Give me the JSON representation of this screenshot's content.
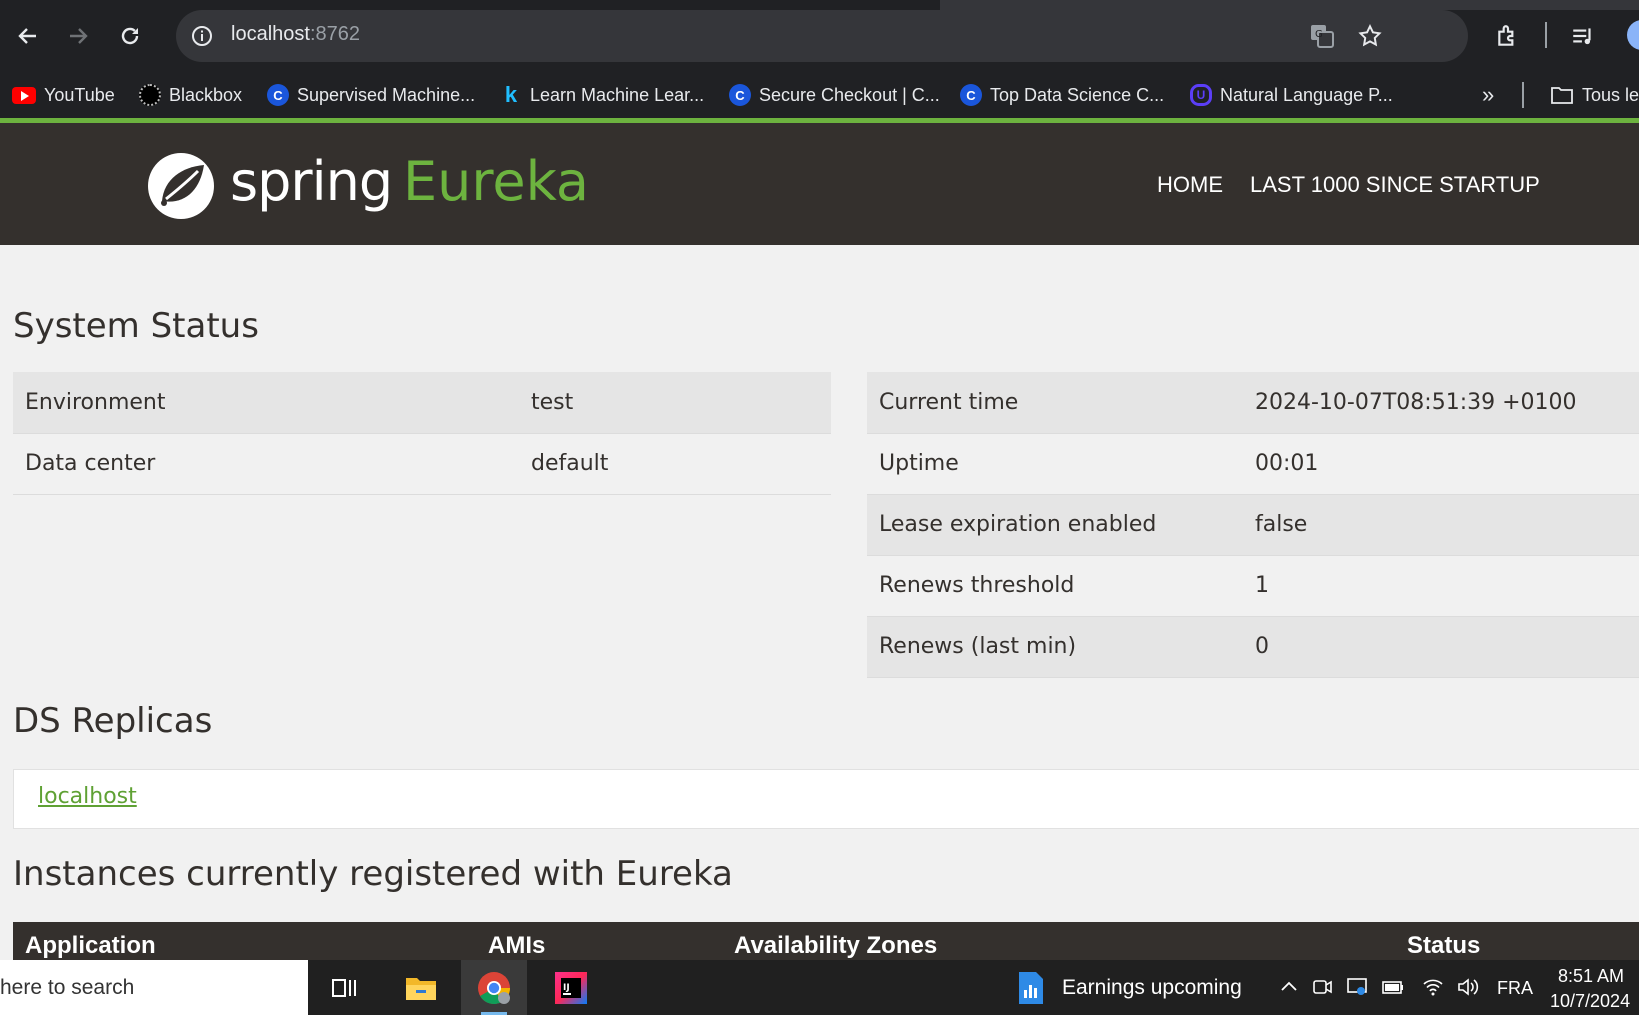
{
  "browser": {
    "url_host": "localhost",
    "url_port": ":8762",
    "bookmarks": [
      {
        "label": "YouTube",
        "icon": "youtube-icon"
      },
      {
        "label": "Blackbox",
        "icon": "blackbox-icon"
      },
      {
        "label": "Supervised Machine...",
        "icon": "coursera-icon"
      },
      {
        "label": "Learn Machine Lear...",
        "icon": "kaggle-icon"
      },
      {
        "label": "Secure Checkout | C...",
        "icon": "coursera-icon"
      },
      {
        "label": "Top Data Science C...",
        "icon": "coursera-icon"
      },
      {
        "label": "Natural Language P...",
        "icon": "udemy-icon"
      }
    ],
    "more_glyph": "»",
    "all_bookmarks": "Tous le"
  },
  "eureka": {
    "logo_spring": "spring",
    "logo_eureka": "Eureka",
    "nav_home": "HOME",
    "nav_last": "LAST 1000 SINCE STARTUP",
    "brand_green": "#6db33f",
    "header_bg": "#34302d"
  },
  "system_status": {
    "title": "System Status",
    "left": [
      {
        "label": "Environment",
        "value": "test"
      },
      {
        "label": "Data center",
        "value": "default"
      }
    ],
    "right": [
      {
        "label": "Current time",
        "value": "2024-10-07T08:51:39 +0100"
      },
      {
        "label": "Uptime",
        "value": "00:01"
      },
      {
        "label": "Lease expiration enabled",
        "value": "false"
      },
      {
        "label": "Renews threshold",
        "value": "1"
      },
      {
        "label": "Renews (last min)",
        "value": "0"
      }
    ]
  },
  "replicas": {
    "title": "DS Replicas",
    "link": "localhost"
  },
  "instances": {
    "title": "Instances currently registered with Eureka",
    "columns": [
      "Application",
      "AMIs",
      "Availability Zones",
      "Status"
    ]
  },
  "taskbar": {
    "search_text": "here to search",
    "widget_text": "Earnings upcoming",
    "language": "FRA",
    "time": "8:51 AM",
    "date": "10/7/2024"
  }
}
